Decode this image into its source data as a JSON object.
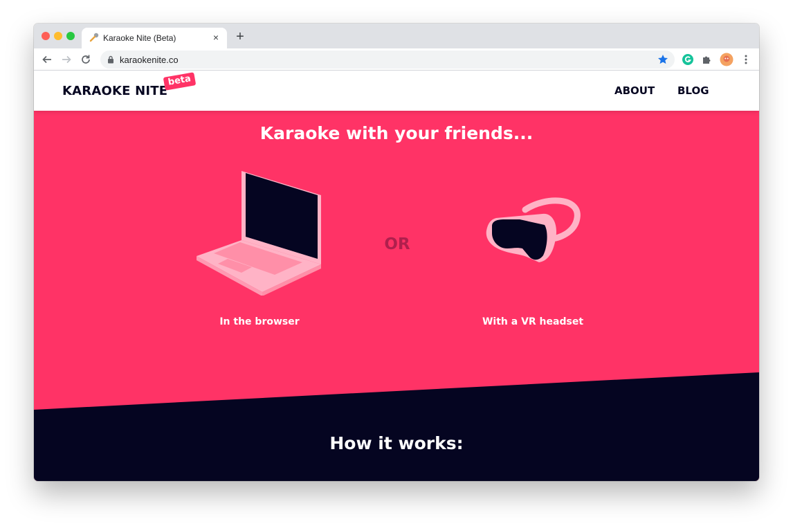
{
  "browser": {
    "tab": {
      "title": "Karaoke Nite (Beta)",
      "close": "×"
    },
    "new_tab": "+",
    "url": "karaokenite.co",
    "colors": {
      "tabstrip": "#dfe1e5",
      "star": "#1a73e8",
      "grammarly": "#15c39a"
    }
  },
  "site": {
    "logo": "KARAOKE NITE",
    "beta_badge": "beta",
    "nav": {
      "about": "ABOUT",
      "blog": "BLOG"
    },
    "hero": {
      "title": "Karaoke with your friends...",
      "or_label": "OR",
      "option_browser": "In the browser",
      "option_vr": "With a VR headset"
    },
    "how_it_works_title": "How it works:",
    "colors": {
      "primary": "#ff3366",
      "dark": "#050521",
      "accent_pink": "#ffb3c6"
    }
  }
}
